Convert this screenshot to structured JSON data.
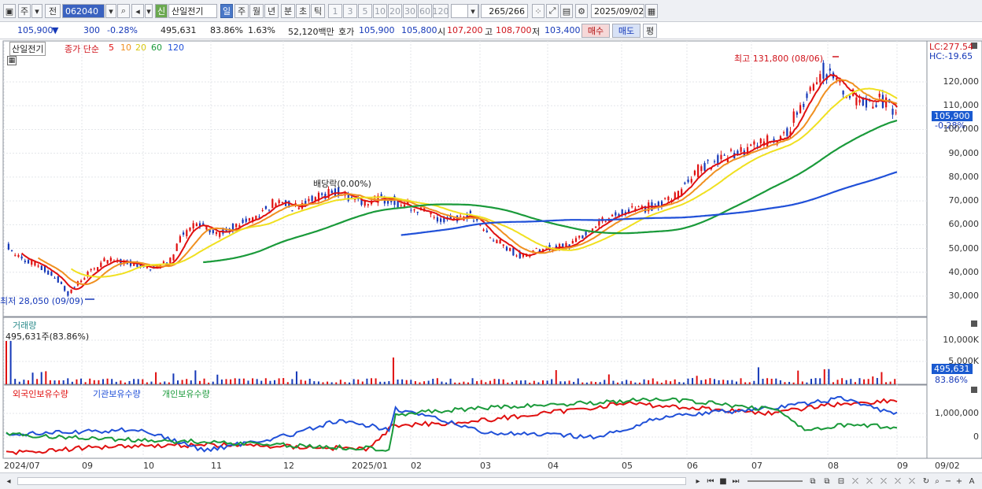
{
  "toolbar": {
    "market": "주",
    "prev": "전",
    "code": "062040",
    "badge": "신",
    "name": "산일전기",
    "periods": [
      "일",
      "주",
      "월",
      "년",
      "분",
      "초",
      "틱"
    ],
    "minutes": [
      "1",
      "3",
      "5",
      "10",
      "20",
      "30",
      "60",
      "120"
    ],
    "count": "265",
    "count_total": "/266",
    "date": "2025/09/02"
  },
  "quote": {
    "price": "105,900",
    "arrow": "▼",
    "change": "300",
    "rate": "-0.28%",
    "volume": "495,631",
    "vol_ratio": "83.86%",
    "turnover": "1.63%",
    "amount": "52,120백만",
    "hoga_label": "호가",
    "hoga_ask": "105,900",
    "hoga_bid": "105,800",
    "open_label": "시",
    "open": "107,200",
    "high_label": "고",
    "high": "108,700",
    "low_label": "저",
    "low": "103,400",
    "buy": "매수",
    "sell": "매도",
    "eval": "평"
  },
  "price_panel": {
    "name_tag": "산일전기",
    "legend_prefix": "종가 단순",
    "ma_labels": [
      "5",
      "10",
      "20",
      "60",
      "120"
    ],
    "ma_colors": [
      "#e01010",
      "#f09020",
      "#f0e020",
      "#1a9a3a",
      "#2050d8"
    ],
    "lc": "LC:277.54",
    "hc": "HC:-19.65",
    "high_note": "최고 131,800 (08/06)",
    "low_note": "최저 28,050 (09/09)",
    "div_note": "배당락(0.00%)",
    "last_price": "105,900",
    "last_rate": "-0.28%",
    "y_ticks": [
      "120,000",
      "110,000",
      "100,000",
      "90,000",
      "80,000",
      "70,000",
      "60,000",
      "50,000",
      "40,000",
      "30,000"
    ]
  },
  "volume_panel": {
    "title": "거래량",
    "info": "495,631주(83.86%)",
    "y_ticks": [
      "10,000K",
      "5,000K"
    ],
    "last_value": "495,631",
    "last_ratio": "83.86%"
  },
  "holder_panel": {
    "legend": [
      "외국인보유수량",
      "기관보유수량",
      "개인보유수량"
    ],
    "colors": [
      "#e01010",
      "#2050d8",
      "#1a9a3a"
    ],
    "y_ticks": [
      "1,000,000",
      "0"
    ]
  },
  "x_labels": [
    "2024/07",
    "09",
    "10",
    "11",
    "12",
    "2025/01",
    "02",
    "03",
    "04",
    "05",
    "06",
    "07",
    "08",
    "09",
    "09/02"
  ]
}
